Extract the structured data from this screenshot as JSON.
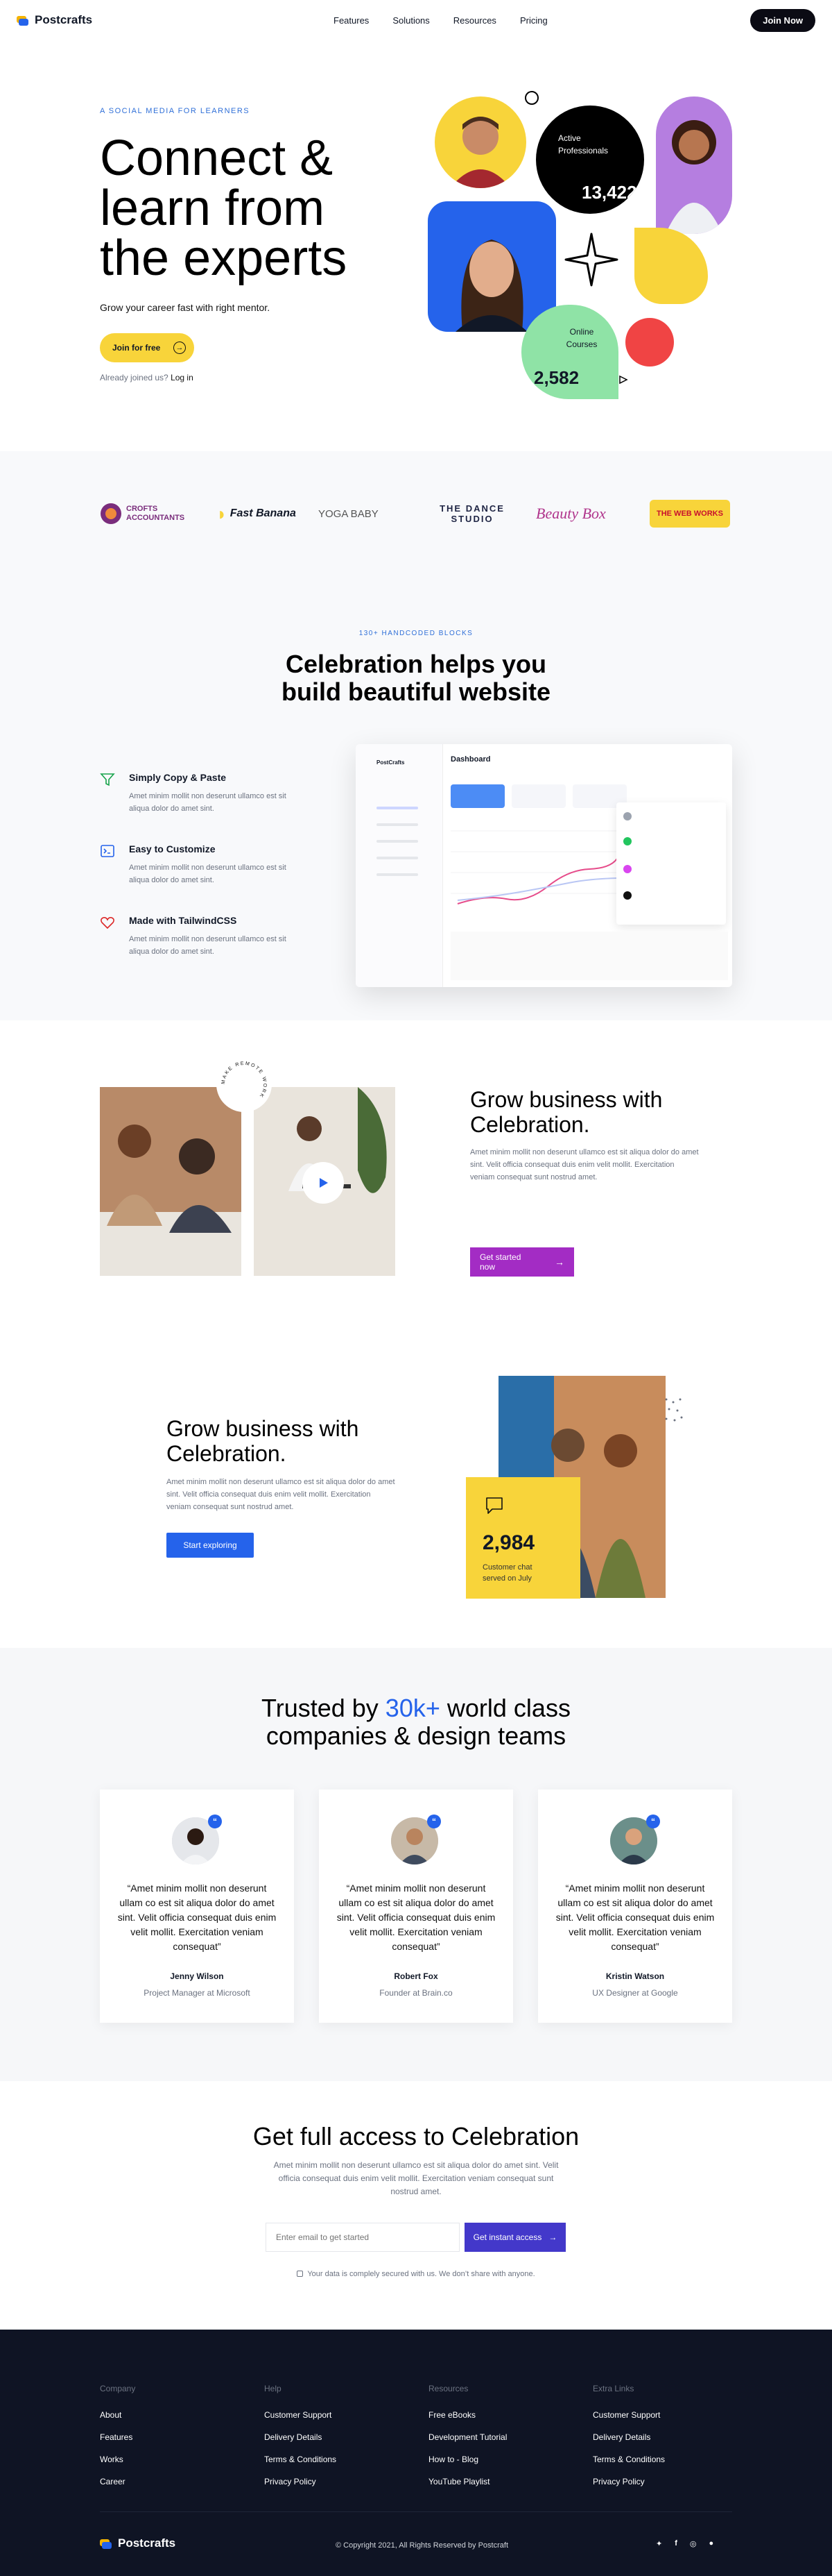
{
  "header": {
    "brand": "Postcrafts",
    "nav": [
      "Features",
      "Solutions",
      "Resources",
      "Pricing"
    ],
    "cta": "Join Now"
  },
  "hero": {
    "tag": "A SOCIAL MEDIA FOR LEARNERS",
    "title": "Connect & learn from the experts",
    "subtitle": "Grow your career fast with right mentor.",
    "cta": "Join for free",
    "login_prefix": "Already joined us?",
    "login_link": "Log in",
    "stat1": {
      "label": "Active Professionals",
      "value": "13,422"
    },
    "stat2": {
      "label": "Online Courses",
      "value": "2,582"
    }
  },
  "brands": [
    "CROFTS ACCOUNTANTS",
    "Fast Banana",
    "YOGA BABY",
    "THE DANCE STUDIO",
    "Beauty Box",
    "THE WEB WORKS"
  ],
  "features": {
    "kicker": "130+ HANDCODED BLOCKS",
    "title": "Celebration helps you build beautiful website",
    "items": [
      {
        "title": "Simply Copy & Paste",
        "text": "Amet minim mollit non deserunt ullamco est sit aliqua dolor do amet sint."
      },
      {
        "title": "Easy to Customize",
        "text": "Amet minim mollit non deserunt ullamco est sit aliqua dolor do amet sint."
      },
      {
        "title": "Made with TailwindCSS",
        "text": "Amet minim mollit non deserunt ullamco est sit aliqua dolor do amet sint."
      }
    ],
    "dashboard": {
      "brand": "PostCrafts",
      "title": "Dashboard"
    }
  },
  "grow1": {
    "title": "Grow business with Celebration.",
    "text": "Amet minim mollit non deserunt ullamco est sit aliqua dolor do amet sint. Velit officia consequat duis enim velit mollit. Exercitation veniam consequat sunt nostrud amet.",
    "cta": "Get started now",
    "badge": "MAKE REMOTE WORK"
  },
  "grow2": {
    "title": "Grow business with Celebration.",
    "text": "Amet minim mollit non deserunt ullamco est sit aliqua dolor do amet sint. Velit officia consequat duis enim velit mollit. Exercitation veniam consequat sunt nostrud amet.",
    "cta": "Start exploring",
    "stat_value": "2,984",
    "stat_label": "Customer chat served on July"
  },
  "trusted": {
    "title_pre": "Trusted by",
    "title_highlight": "30k+",
    "title_post": "world class companies & design teams",
    "items": [
      {
        "quote": "“Amet minim mollit non deserunt ullam co est sit aliqua dolor do amet sint. Velit officia consequat duis enim velit mollit. Exercitation veniam consequat”",
        "name": "Jenny Wilson",
        "role": "Project Manager at Microsoft"
      },
      {
        "quote": "“Amet minim mollit non deserunt ullam co est sit aliqua dolor do amet sint. Velit officia consequat duis enim velit mollit. Exercitation veniam consequat”",
        "name": "Robert Fox",
        "role": "Founder at Brain.co"
      },
      {
        "quote": "“Amet minim mollit non deserunt ullam co est sit aliqua dolor do amet sint. Velit officia consequat duis enim velit mollit. Exercitation veniam consequat”",
        "name": "Kristin Watson",
        "role": "UX Designer at Google"
      }
    ]
  },
  "cta": {
    "title": "Get full access to Celebration",
    "text": "Amet minim mollit non deserunt ullamco est sit aliqua dolor do amet sint. Velit officia consequat duis enim velit mollit. Exercitation veniam consequat sunt nostrud amet.",
    "placeholder": "Enter email to get started",
    "button": "Get instant access",
    "note": "Your data is complely secured with us. We don’t share with anyone."
  },
  "footer": {
    "cols": [
      {
        "head": "Company",
        "links": [
          "About",
          "Features",
          "Works",
          "Career"
        ]
      },
      {
        "head": "Help",
        "links": [
          "Customer Support",
          "Delivery Details",
          "Terms & Conditions",
          "Privacy Policy"
        ]
      },
      {
        "head": "Resources",
        "links": [
          "Free eBooks",
          "Development Tutorial",
          "How to - Blog",
          "YouTube Playlist"
        ]
      },
      {
        "head": "Extra Links",
        "links": [
          "Customer Support",
          "Delivery Details",
          "Terms & Conditions",
          "Privacy Policy"
        ]
      }
    ],
    "brand": "Postcrafts",
    "copyright": "© Copyright 2021, All Rights Reserved by Postcraft"
  },
  "colors": {
    "accent": "#2563eb",
    "yellow": "#f8d43a",
    "purple": "#a32cc4",
    "footer": "#0f1424"
  }
}
